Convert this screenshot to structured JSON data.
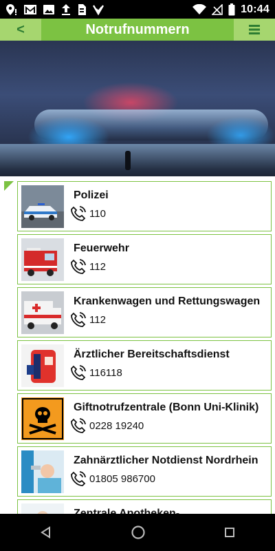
{
  "status_bar": {
    "time": "10:44",
    "left_icons": [
      "location-alert-icon",
      "gmail-icon",
      "image-icon",
      "upload-icon",
      "sim-icon",
      "checklist-icon"
    ],
    "right_icons": [
      "wifi-icon",
      "signal-off-icon",
      "battery-icon"
    ]
  },
  "app_bar": {
    "back_label": "<",
    "title": "Notrufnummern",
    "menu_icon": "menu-icon"
  },
  "colors": {
    "accent": "#7cc242",
    "accent_light": "#a6d66f",
    "back_arrow": "#2e7d32"
  },
  "contacts": [
    {
      "name": "Polizei",
      "number": "110",
      "image": "police-car"
    },
    {
      "name": "Feuerwehr",
      "number": "112",
      "image": "fire-truck"
    },
    {
      "name": "Krankenwagen und Rettungswagen",
      "number": "112",
      "image": "ambulance"
    },
    {
      "name": "Ärztlicher Bereitschaftsdienst",
      "number": "116118",
      "image": "medical-bag"
    },
    {
      "name": "Giftnotrufzentrale (Bonn Uni-Klinik)",
      "number": "0228 19240",
      "image": "poison-sign"
    },
    {
      "name": "Zahnärztlicher Notdienst Nordrhein",
      "number": "01805 986700",
      "image": "dentist"
    },
    {
      "name": "Zentrale Apotheken-",
      "number": "",
      "image": "pharmacist"
    }
  ],
  "nav_bar": {
    "buttons": [
      "back-triangle-icon",
      "home-circle-icon",
      "recents-square-icon"
    ]
  }
}
